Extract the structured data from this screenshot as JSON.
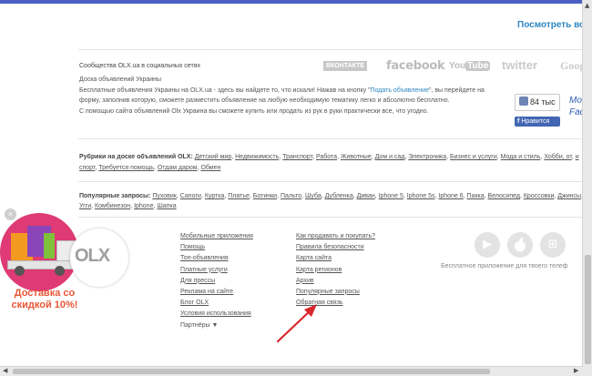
{
  "header": {
    "see_all": "Посмотреть все"
  },
  "social": {
    "heading": "Сообщества OLX.ua в социальных сетях",
    "logos": {
      "vk": "ВКОНТАКТЕ",
      "facebook": "facebook",
      "youtube_a": "You",
      "youtube_b": "Tube",
      "twitter": "twitter",
      "google": "Goog"
    },
    "line1": "Доска объявлений Украины",
    "line2_a": "Бесплатные объявления Украины на OLX.ua - здесь вы найдете то, что искали! Нажав на кнопку \"",
    "post_ad_link": "Подать объявление",
    "line2_b": "\", вы перейдете на",
    "line3": "форму, заполнив которую, сможете разместить объявление на любую необходимую тематику легко и абсолютно бесплатно.",
    "line4": "С помощью сайта объявлений Olx Украина вы сможете купить или продать из рук в руки практически все, что угодно."
  },
  "facebook_widget": {
    "like_count": "84 тыс",
    "like_button": "Нравится",
    "side_1": "Mo",
    "side_2": "Fac"
  },
  "rubrics": {
    "label": "Рубрики на доске объявлений OLX:",
    "items": [
      "Детский мир",
      "Недвижимость",
      "Транспорт",
      "Работа",
      "Животные",
      "Дом и сад",
      "Электроника",
      "Бизнес и услуги",
      "Мода и стиль",
      "Хобби, от",
      "и спорт",
      "Требуется помощь",
      "Отдам даром",
      "Обмен"
    ]
  },
  "popular_queries": {
    "label": "Популярные запросы:",
    "items": [
      "Пуховик",
      "Сапоги",
      "Куртка",
      "Платье",
      "Ботинки",
      "Пальто",
      "Шуба",
      "Дубленка",
      "Диван",
      "Iphone 5",
      "Iphone 5s",
      "Iphone 6",
      "Пакка",
      "Велосипед",
      "Кроссовки",
      "Джинсы",
      "Угги",
      "Комбинезон",
      "Iphone",
      "Шапка"
    ]
  },
  "footer": {
    "col1": [
      "Мобильные приложения",
      "Помощь",
      "Топ-объявления",
      "Платные услуги",
      "Для прессы",
      "Реклама на сайте",
      "Блог OLX",
      "Условия использования"
    ],
    "partners": "Партнёры",
    "partners_arrow": "▼",
    "col2": [
      "Как продавать и покупать?",
      "Правила безопасности",
      "Карта сайта",
      "Карта регионов",
      "Архив",
      "Популярные запросы",
      "Обратная связь"
    ],
    "app_caption": "Бесплатное приложение для твоего телеф"
  },
  "store_icons": {
    "google": "▶",
    "apple": "",
    "windows": "⊞"
  },
  "promo": {
    "close": "×",
    "olx": "OLX",
    "text": "Доставка со скидкой 10%!",
    "brand_pink": "#df3a74",
    "text_color": "#ea5637"
  },
  "scrollbars": {
    "up": "▲",
    "left": "◀",
    "right": "▶"
  },
  "colors": {
    "link": "#2e86c1",
    "facebook": "#4266b2",
    "arrow": "#d8262b"
  }
}
